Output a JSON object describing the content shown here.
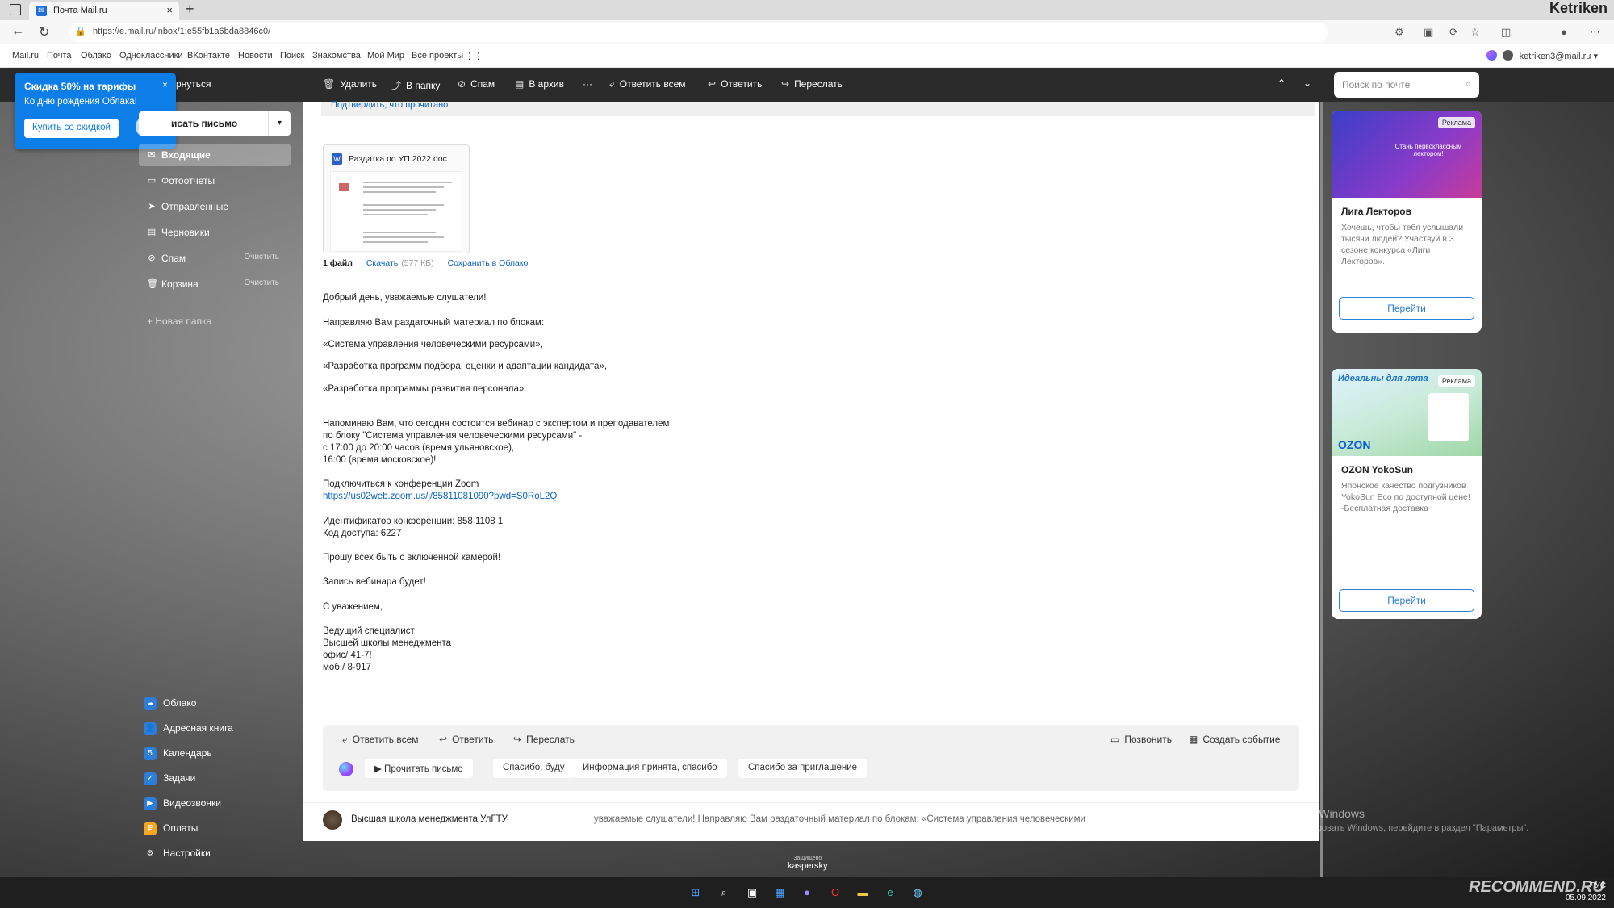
{
  "browser": {
    "tab_title": "Почта Mail.ru",
    "url": "https://e.mail.ru/inbox/1:e55fb1a6bda8846c0/",
    "profile": "Ketriken"
  },
  "portal": {
    "links": [
      "Mail.ru",
      "Почта",
      "Облако",
      "Одноклассники",
      "ВКонтакте",
      "Новости",
      "Поиск",
      "Знакомства",
      "Мой Мир",
      "Все проекты"
    ],
    "user_email": "ketriken3@mail.ru ▾"
  },
  "promo": {
    "title": "Скидка 50% на тарифы",
    "subtitle": "Ко дню рождения Облака!",
    "button": "Купить со скидкой",
    "close": "×"
  },
  "toolbar": {
    "back": "рнуться",
    "delete": "Удалить",
    "to_folder": "В папку",
    "spam": "Спам",
    "archive": "В архив",
    "more": "···",
    "reply_all": "Ответить всем",
    "reply": "Ответить",
    "forward": "Переслать",
    "search_placeholder": "Поиск по почте"
  },
  "compose": {
    "label": "исать письмо"
  },
  "folders": [
    {
      "label": "Входящие",
      "icon": "inbox-icon",
      "action": ""
    },
    {
      "label": "Фотоотчеты",
      "icon": "folder-icon",
      "action": ""
    },
    {
      "label": "Отправленные",
      "icon": "sent-icon",
      "action": ""
    },
    {
      "label": "Черновики",
      "icon": "draft-icon",
      "action": ""
    },
    {
      "label": "Спам",
      "icon": "spam-icon",
      "action": "Очистить"
    },
    {
      "label": "Корзина",
      "icon": "trash-icon",
      "action": "Очистить"
    }
  ],
  "new_folder": "Новая папка",
  "apps": [
    {
      "label": "Облако",
      "color": "#2d7ed9"
    },
    {
      "label": "Адресная книга",
      "color": "#2d7ed9"
    },
    {
      "label": "Календарь",
      "color": "#2d7ed9"
    },
    {
      "label": "Задачи",
      "color": "#2d7ed9"
    },
    {
      "label": "Видеозвонки",
      "color": "#2d7ed9"
    },
    {
      "label": "Оплаты",
      "color": "#f5a623"
    },
    {
      "label": "Настройки",
      "color": "#555555"
    }
  ],
  "letter": {
    "confirm_read": "Подтвердить, что прочитано",
    "attachment": {
      "filename": "Раздатка по УП 2022.doc",
      "count": "1 файл",
      "download": "Скачать",
      "size": "(577 КБ)",
      "save_cloud": "Сохранить в Облако"
    },
    "lines": [
      "Добрый день, уважаемые слушатели!",
      "Направляю Вам раздаточный материал по блокам:",
      "«Система управления человеческими ресурсами»,",
      "«Разработка программ подбора, оценки и адаптации кандидата»,",
      "«Разработка программы развития персонала»",
      "Напоминаю Вам, что сегодня состоится вебинар с экспертом и преподавателем",
      "по блоку \"Система управления человеческими ресурсами\" -",
      "с 17:00 до 20:00 часов (время ульяновское),",
      "16:00 (время московское)!",
      "Подключиться к конференции Zoom",
      "https://us02web.zoom.us/j/85811081090?pwd=S0RoL2Q",
      "Идентификатор конференции: 858 1108 1",
      "Код доступа: 6227",
      "Прошу всех быть с включенной камерой!",
      "Запись вебинара будет!",
      "С уважением,",
      "Ведущий специалист",
      "Высшей школы менеджмента",
      "офис/ 41-7!",
      "моб./ 8-917"
    ]
  },
  "reply_panel": {
    "reply_all": "Ответить всем",
    "reply": "Ответить",
    "forward": "Переслать",
    "call": "Позвонить",
    "event": "Создать событие",
    "quick": [
      "Прочитать письмо",
      "Спасибо, буду",
      "Информация принята, спасибо",
      "Спасибо за приглашение"
    ]
  },
  "thread": {
    "sender": "Высшая школа менеджмента УлГТУ",
    "snippet": "уважаемые слушатели! Направляю Вам раздаточный материал по блокам: «Система управления человеческими"
  },
  "ads": [
    {
      "tag": "Реклама",
      "title": "Лига Лекторов",
      "text": "Хочешь, чтобы тебя услышали тысячи людей? Участвуй в 3 сезоне конкурса «Лиги Лекторов».",
      "button": "Перейти",
      "banner_text": "Стань первоклассным лектором!"
    },
    {
      "tag": "Реклама",
      "title": "OZON YokoSun",
      "text": "Японское качество подгузников YokoSun Eco по доступной цене! -Бесплатная доставка",
      "button": "Перейти",
      "banner_text": "Идеальны для лета",
      "brand": "OZON"
    }
  ],
  "watermarks": {
    "activate_title": "Активация Windows",
    "activate_text": "Чтобы активировать Windows, перейдите в раздел \"Параметры\".",
    "kaspersky_small": "Защищено",
    "kaspersky": "kaspersky",
    "recommend": "RECOMMEND.RU"
  },
  "taskbar": {
    "lang": "РУС",
    "date": "05.09.2022"
  }
}
